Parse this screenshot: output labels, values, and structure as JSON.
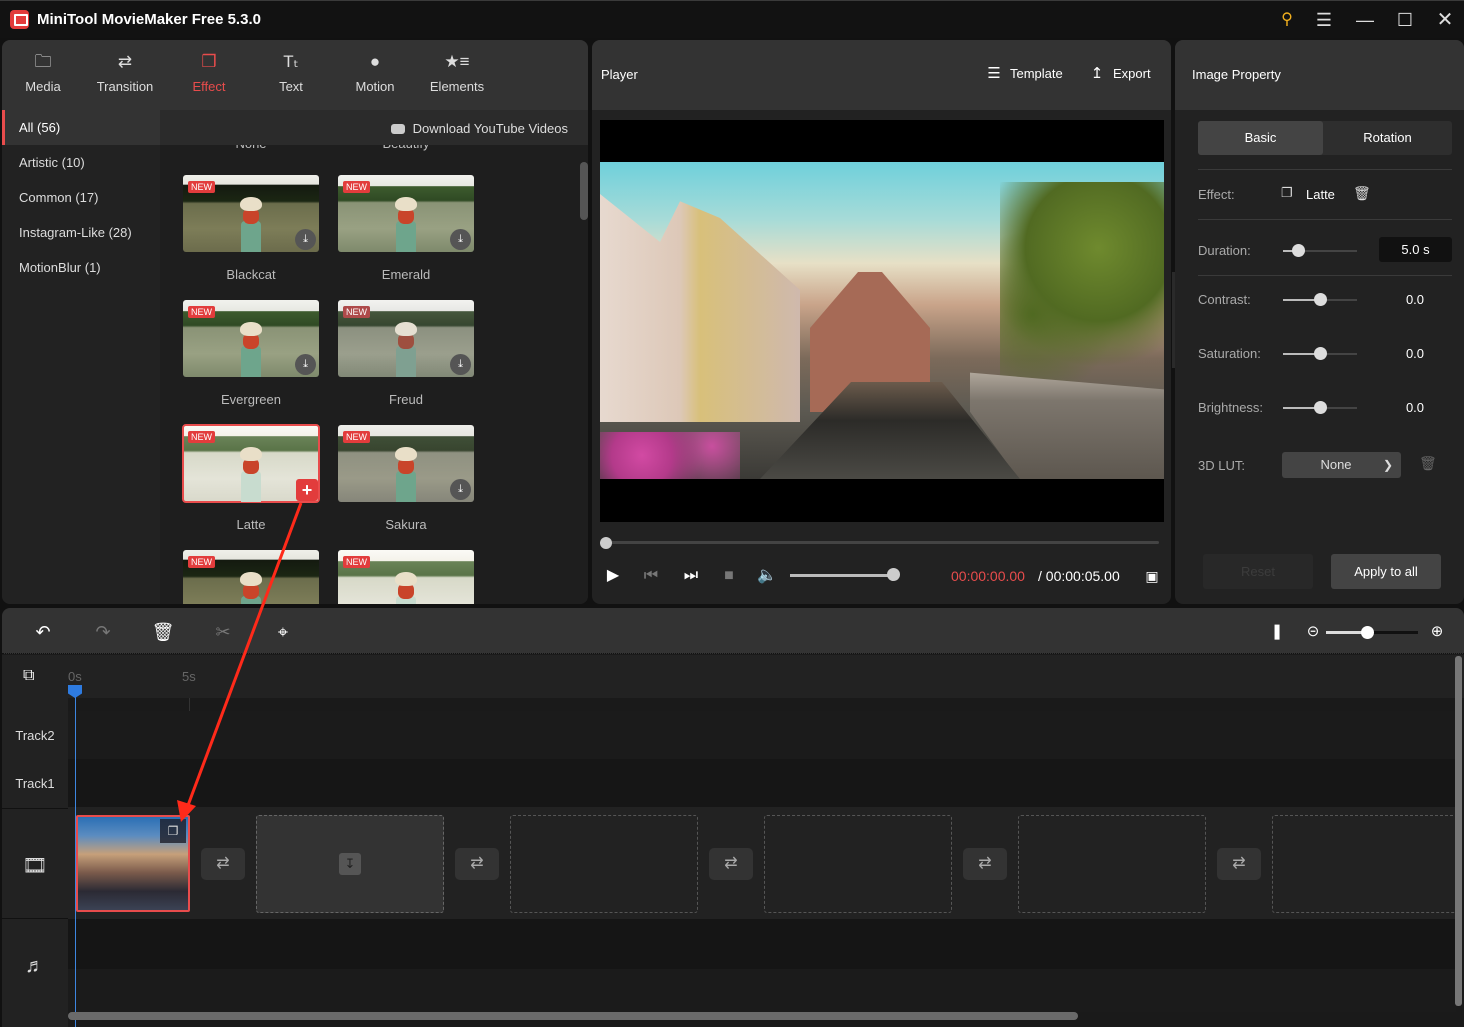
{
  "window": {
    "title": "MiniTool MovieMaker Free 5.3.0",
    "controls": [
      "key-icon",
      "menu-icon",
      "minimize-icon",
      "maximize-icon",
      "close-icon"
    ]
  },
  "media_panel": {
    "tabs": [
      {
        "label": "Media",
        "icon": "folder-icon",
        "active": false
      },
      {
        "label": "Transition",
        "icon": "swap-arrows-icon",
        "active": false
      },
      {
        "label": "Effect",
        "icon": "effect-layers-icon",
        "active": true
      },
      {
        "label": "Text",
        "icon": "text-icon",
        "active": false
      },
      {
        "label": "Motion",
        "icon": "motion-icon",
        "active": false
      },
      {
        "label": "Elements",
        "icon": "star-list-icon",
        "active": false
      }
    ],
    "categories": [
      {
        "label": "All (56)",
        "active": true
      },
      {
        "label": "Artistic (10)",
        "active": false
      },
      {
        "label": "Common (17)",
        "active": false
      },
      {
        "label": "Instagram-Like (28)",
        "active": false
      },
      {
        "label": "MotionBlur (1)",
        "active": false
      }
    ],
    "download_youtube": "Download YouTube Videos",
    "cut_off_labels": [
      "None",
      "Beautify"
    ],
    "new_badge": "NEW",
    "effects": [
      {
        "name": "Blackcat",
        "badge": "NEW",
        "action": "download"
      },
      {
        "name": "Emerald",
        "badge": "NEW",
        "action": "download"
      },
      {
        "name": "Evergreen",
        "badge": "NEW",
        "action": "download"
      },
      {
        "name": "Freud",
        "badge": "NEW",
        "action": "download"
      },
      {
        "name": "Latte",
        "badge": "NEW",
        "action": "add",
        "selected": true
      },
      {
        "name": "Sakura",
        "badge": "NEW",
        "action": "download"
      },
      {
        "name": "",
        "badge": "NEW",
        "action": "download"
      },
      {
        "name": "",
        "badge": "NEW",
        "action": "download"
      }
    ]
  },
  "player": {
    "title": "Player",
    "template_label": "Template",
    "export_label": "Export",
    "current_time": "00:00:00.00",
    "total_time": "/ 00:00:05.00",
    "progress_fraction": 0.0,
    "volume_fraction": 1.0
  },
  "properties": {
    "title": "Image Property",
    "tabs": [
      {
        "label": "Basic",
        "active": true
      },
      {
        "label": "Rotation",
        "active": false
      }
    ],
    "effect_label": "Effect:",
    "effect_value": "Latte",
    "duration_label": "Duration:",
    "duration_value": "5.0 s",
    "duration_slider_fraction": 0.2,
    "contrast_label": "Contrast:",
    "contrast_value": "0.0",
    "saturation_label": "Saturation:",
    "saturation_value": "0.0",
    "brightness_label": "Brightness:",
    "brightness_value": "0.0",
    "adjust_slider_fraction": 0.5,
    "lut_label": "3D LUT:",
    "lut_value": "None",
    "reset_label": "Reset",
    "apply_label": "Apply to all"
  },
  "timeline": {
    "ruler_labels": [
      "0s",
      "5s"
    ],
    "tracks": [
      "Track2",
      "Track1"
    ],
    "zoom_fraction": 0.45,
    "clip_has_effect": true,
    "empty_slot_count": 5
  },
  "annotation": {
    "color": "#ff2a1a",
    "description": "arrow from Latte add button to timeline clip"
  },
  "colors": {
    "accent": "#e84c4c",
    "playhead": "#2e7be0",
    "key_icon": "#f2b01e"
  }
}
